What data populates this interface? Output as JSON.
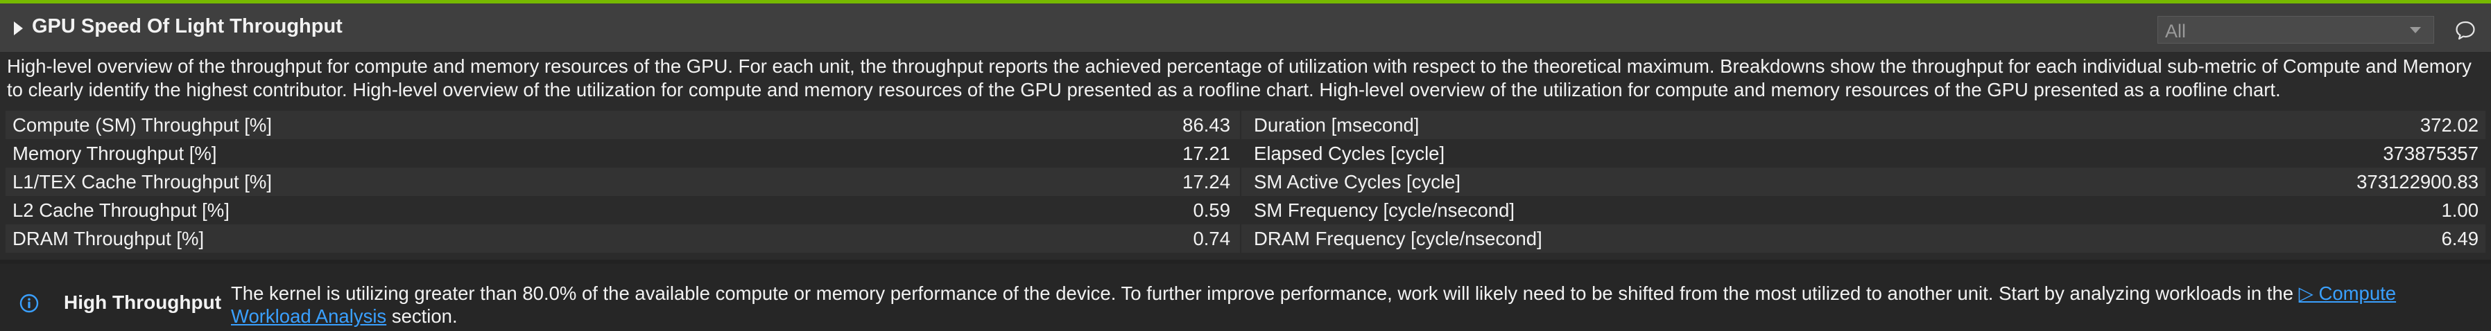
{
  "header": {
    "title": "GPU Speed Of Light Throughput",
    "filter_value": "All",
    "accent_color": "#76b900"
  },
  "description": "High-level overview of the throughput for compute and memory resources of the GPU. For each unit, the throughput reports the achieved percentage of utilization with respect to the theoretical maximum. Breakdowns show the throughput for each individual sub-metric of Compute and Memory to clearly identify the highest contributor. High-level overview of the utilization for compute and memory resources of the GPU presented as a roofline chart. High-level overview of the utilization for compute and memory resources of the GPU presented as a roofline chart.",
  "metrics": {
    "left": [
      {
        "label": "Compute (SM) Throughput [%]",
        "value": "86.43"
      },
      {
        "label": "Memory Throughput [%]",
        "value": "17.21"
      },
      {
        "label": "L1/TEX Cache Throughput [%]",
        "value": "17.24"
      },
      {
        "label": "L2 Cache Throughput [%]",
        "value": "0.59"
      },
      {
        "label": "DRAM Throughput [%]",
        "value": "0.74"
      }
    ],
    "right": [
      {
        "label": "Duration [msecond]",
        "value": "372.02"
      },
      {
        "label": "Elapsed Cycles [cycle]",
        "value": "373875357"
      },
      {
        "label": "SM Active Cycles [cycle]",
        "value": "373122900.83"
      },
      {
        "label": "SM Frequency [cycle/nsecond]",
        "value": "1.00"
      },
      {
        "label": "DRAM Frequency [cycle/nsecond]",
        "value": "6.49"
      }
    ]
  },
  "rule": {
    "icon": "info-icon",
    "title": "High Throughput",
    "text_before": "The kernel is utilizing greater than 80.0% of the available compute or memory performance of the device. To further improve performance, work will likely need to be shifted from the most utilized to another unit. Start by analyzing workloads in the ",
    "link_text": "▷ Compute Workload Analysis",
    "text_after": " section.",
    "link_color": "#3aa0ff"
  }
}
